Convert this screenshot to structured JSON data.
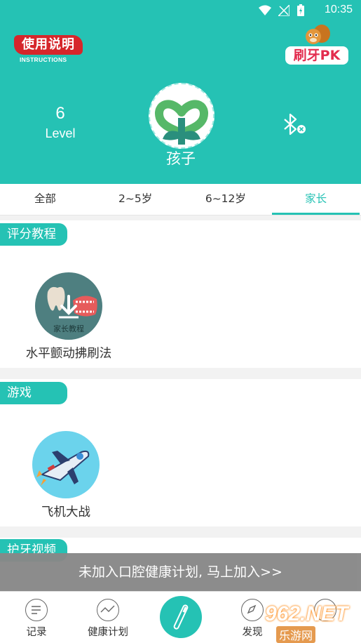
{
  "status_bar": {
    "time": "10:35"
  },
  "header": {
    "logo_left": {
      "main": "使用说明",
      "sub": "INSTRUCTIONS"
    },
    "logo_right": {
      "text": "刷牙PK"
    },
    "level": {
      "value": "6",
      "label": "Level"
    },
    "profile": {
      "name": "孩子"
    },
    "bluetooth_icon": "bluetooth-disconnected-icon"
  },
  "tabs": [
    {
      "label": "全部",
      "active": false
    },
    {
      "label": "2~5岁",
      "active": false
    },
    {
      "label": "6~12岁",
      "active": false
    },
    {
      "label": "家长",
      "active": true
    }
  ],
  "sections": {
    "scoring": {
      "title": "评分教程",
      "items": [
        {
          "label": "水平颤动拂刷法",
          "badge": "家长教程"
        }
      ]
    },
    "games": {
      "title": "游戏",
      "items": [
        {
          "label": "飞机大战"
        }
      ]
    },
    "videos": {
      "title": "护牙视频"
    }
  },
  "join_banner": {
    "text": "未加入口腔健康计划, 马上加入>>"
  },
  "tabbar": {
    "items": [
      {
        "label": "记录",
        "icon": "list-icon"
      },
      {
        "label": "健康计划",
        "icon": "chart-line-icon"
      },
      {
        "label": "",
        "icon": "toothbrush-icon"
      },
      {
        "label": "发现",
        "icon": "compass-icon"
      },
      {
        "label": "",
        "icon": "profile-icon"
      }
    ]
  },
  "watermark": {
    "line1": "962.NET",
    "line2": "乐游网"
  },
  "colors": {
    "accent": "#25c2b4",
    "banner_gray": "#888888"
  }
}
